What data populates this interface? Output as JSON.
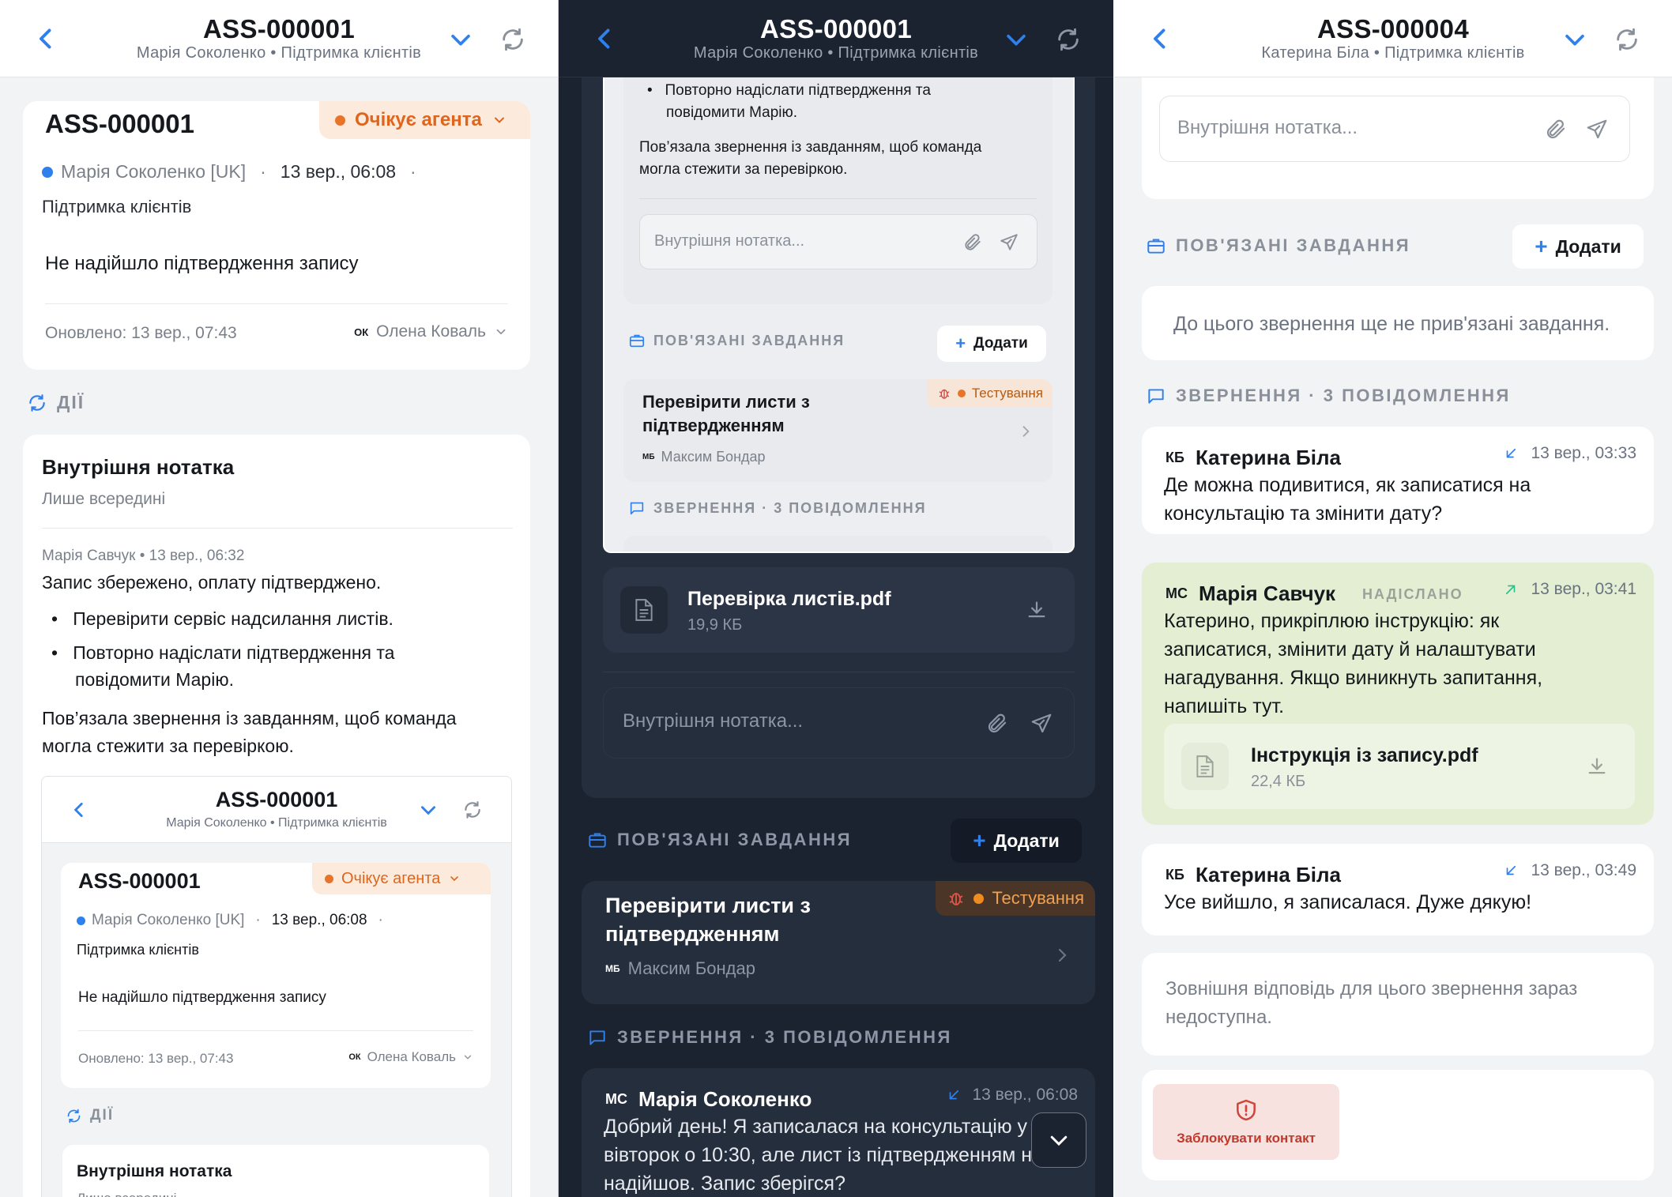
{
  "left": {
    "header": {
      "title": "ASS-000001",
      "subtitle": "Марія Соколенко • Підтримка клієнтів"
    },
    "ticket": {
      "id": "ASS-000001",
      "status": "Очікує агента",
      "customer": "Марія Соколенко [UK]",
      "date": "13 вер., 06:08",
      "queue": "Підтримка клієнтів",
      "subject": "Не надійшло підтвердження запису",
      "updated": "Оновлено: 13 вер., 07:43",
      "assignee_initials": "ОК",
      "assignee": "Олена Коваль"
    },
    "actions_label": "ДІЇ",
    "note": {
      "title": "Внутрішня нотатка",
      "subtitle": "Лише всередині",
      "meta": "Марія Савчук • 13 вер., 06:32",
      "line1": "Запис збережено, оплату підтверджено.",
      "bullet1": "Перевірити сервіс надсилання листів.",
      "bullet2a": "Повторно надіслати підтвердження та",
      "bullet2b": "повідомити Марію.",
      "text_a": "Пов’язала звернення із завданням, щоб команда",
      "text_b": "могла стежити за перевіркою."
    },
    "nested": {
      "header_title": "ASS-000001",
      "header_sub": "Марія Соколенко • Підтримка клієнтів",
      "id": "ASS-000001",
      "status": "Очікує агента",
      "customer": "Марія Соколенко [UK]",
      "date": "13 вер., 06:08",
      "queue": "Підтримка клієнтів",
      "subject": "Не надійшло підтвердження запису",
      "updated": "Оновлено: 13 вер., 07:43",
      "assignee_initials": "ОК",
      "assignee": "Олена Коваль",
      "actions_label": "ДІЇ",
      "note_title": "Внутрішня нотатка",
      "note_sub": "Лише всередині"
    }
  },
  "middle": {
    "header": {
      "title": "ASS-000001",
      "subtitle": "Марія Соколенко • Підтримка клієнтів"
    },
    "inner": {
      "bullet_a": "Повторно надіслати підтвердження та",
      "bullet_b": "повідомити Марію.",
      "text_a": "Пов’язала звернення із завданням, щоб команда",
      "text_b": "могла стежити за перевіркою.",
      "note_placeholder": "Внутрішня нотатка...",
      "tasks_label": "ПОВ'ЯЗАНІ ЗАВДАННЯ",
      "add": "Додати",
      "task_a": "Перевірити листи з",
      "task_b": "підтвердженням",
      "task_status": "Тестування",
      "task_owner_initials": "МБ",
      "task_owner": "Максим Бондар",
      "messages_label": "ЗВЕРНЕННЯ · 3 ПОВІДОМЛЕННЯ"
    },
    "attachment": {
      "name": "Перевірка листів.pdf",
      "size": "19,9 КБ"
    },
    "note_placeholder": "Внутрішня нотатка...",
    "tasks_label": "ПОВ'ЯЗАНІ ЗАВДАННЯ",
    "add": "Додати",
    "task": {
      "title_a": "Перевірити листи з",
      "title_b": "підтвердженням",
      "status": "Тестування",
      "owner_initials": "МБ",
      "owner": "Максим Бондар"
    },
    "messages_label": "ЗВЕРНЕННЯ · 3 ПОВІДОМЛЕННЯ",
    "message": {
      "initials": "МС",
      "author": "Марія Соколенко",
      "time": "13 вер., 06:08",
      "line1": "Добрий день! Я записалася на консультацію у",
      "line2": "вівторок о 10:30, але лист із підтвердженням не",
      "line3": "надійшов. Запис зберігся?"
    }
  },
  "right": {
    "header": {
      "title": "ASS-000004",
      "subtitle": "Катерина Біла • Підтримка клієнтів"
    },
    "note_placeholder": "Внутрішня нотатка...",
    "tasks_label": "ПОВ'ЯЗАНІ ЗАВДАННЯ",
    "add": "Додати",
    "no_tasks": "До цього звернення ще не прив'язані завдання.",
    "messages_label": "ЗВЕРНЕННЯ · 3 ПОВІДОМЛЕННЯ",
    "msg1": {
      "initials": "КБ",
      "author": "Катерина Біла",
      "time": "13 вер., 03:33",
      "line1": "Де можна подивитися, як записатися на",
      "line2": "консультацію та змінити дату?"
    },
    "msg2": {
      "initials": "МС",
      "author": "Марія Савчук",
      "badge": "НАДІСЛАНО",
      "time": "13 вер., 03:41",
      "line1": "Катерино, прикріплюю інструкцію: як",
      "line2": "записатися, змінити дату й налаштувати",
      "line3": "нагадування. Якщо виникнуть запитання,",
      "line4": "напишіть тут.",
      "file": "Інструкція із запису.pdf",
      "size": "22,4 КБ"
    },
    "msg3": {
      "initials": "КБ",
      "author": "Катерина Біла",
      "time": "13 вер., 03:49",
      "line1": "Усе вийшло, я записалася. Дуже дякую!"
    },
    "unavailable_a": "Зовнішня відповідь для цього звернення зараз",
    "unavailable_b": "недоступна.",
    "block": "Заблокувати контакт"
  },
  "colors": {
    "accent": "#2f80ed",
    "status_orange": "#e8742a",
    "sent_green": "#e3eed2",
    "danger": "#d0453b"
  }
}
